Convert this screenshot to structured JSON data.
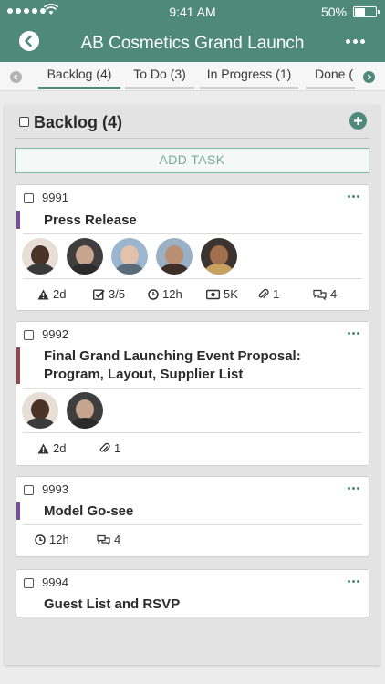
{
  "status_bar": {
    "time": "9:41 AM",
    "battery": "50%",
    "battery_level": 0.5
  },
  "nav": {
    "title": "AB Cosmetics Grand Launch"
  },
  "tabs": [
    {
      "label": "Backlog (4)",
      "active": true
    },
    {
      "label": "To Do (3)",
      "active": false
    },
    {
      "label": "In Progress (1)",
      "active": false
    },
    {
      "label": "Done (",
      "active": false
    }
  ],
  "column": {
    "title": "Backlog (4)",
    "add_task_label": "ADD TASK"
  },
  "cards": [
    {
      "id": "9991",
      "title": "Press Release",
      "stripe_color": "#7a4e96",
      "meta": {
        "warning": "2d",
        "checklist": "3/5",
        "time": "12h",
        "money": "5K",
        "attachments": "1",
        "comments": "4"
      }
    },
    {
      "id": "9992",
      "title_line1": "Final Grand Launching Event Proposal:",
      "title_line2": "Program, Layout, Supplier List",
      "stripe_color": "#8d4a4c",
      "meta": {
        "warning": "2d",
        "attachments": "1"
      }
    },
    {
      "id": "9993",
      "title": "Model Go-see",
      "stripe_color": "#7a4e96",
      "meta": {
        "time": "12h",
        "comments": "4"
      }
    },
    {
      "id": "9994",
      "title": "Guest List and RSVP"
    }
  ],
  "colors": {
    "accent": "#4f8a79",
    "tab_active_underline": "#4f8a79"
  }
}
